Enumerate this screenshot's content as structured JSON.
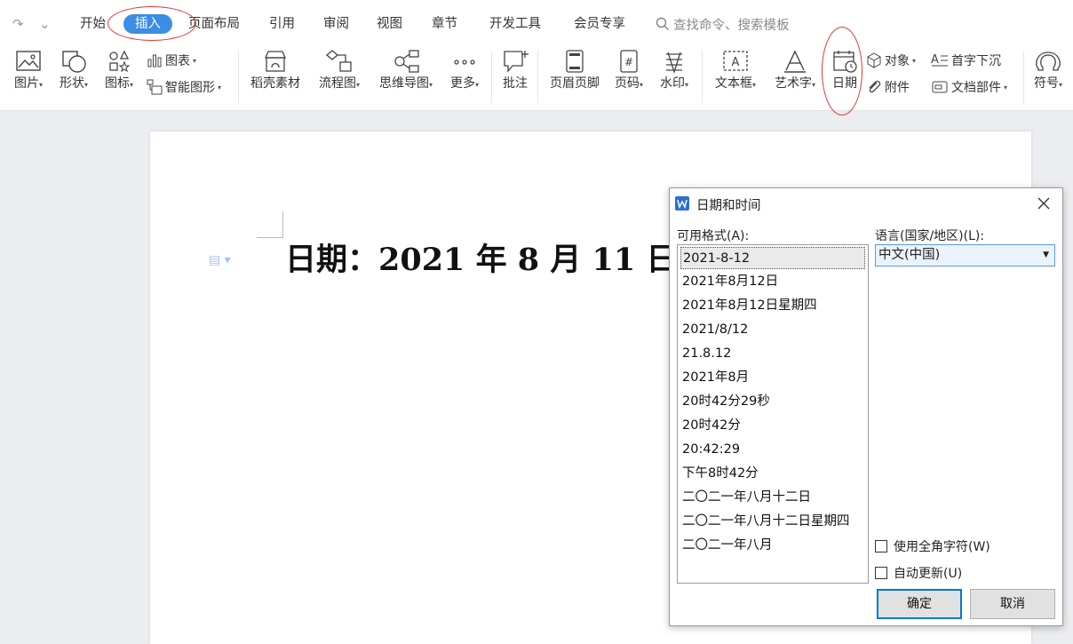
{
  "menu": {
    "tabs": [
      "开始",
      "插入",
      "页面布局",
      "引用",
      "审阅",
      "视图",
      "章节",
      "开发工具",
      "会员专享"
    ],
    "active_tab": "插入",
    "search_placeholder": "查找命令、搜索模板"
  },
  "ribbon": {
    "picture": "图片",
    "shape": "形状",
    "icons": "图标",
    "chart": "图表",
    "smart_graphic": "智能图形",
    "daoke": "稻壳素材",
    "flowchart": "流程图",
    "mindmap": "思维导图",
    "more": "更多",
    "comment": "批注",
    "header_footer": "页眉页脚",
    "page_number": "页码",
    "watermark": "水印",
    "textbox": "文本框",
    "wordart": "艺术字",
    "date": "日期",
    "object": "对象",
    "dropcap": "首字下沉",
    "attachment": "附件",
    "doc_parts": "文档部件",
    "symbol": "符号"
  },
  "document": {
    "text": "日期：2021 年 8 月 11 日"
  },
  "dialog": {
    "title": "日期和时间",
    "formats_label": "可用格式(A):",
    "language_label": "语言(国家/地区)(L):",
    "formats": [
      "2021-8-12",
      "2021年8月12日",
      "2021年8月12日星期四",
      "2021/8/12",
      "21.8.12",
      "2021年8月",
      "20时42分29秒",
      "20时42分",
      "20:42:29",
      "下午8时42分",
      "二〇二一年八月十二日",
      "二〇二一年八月十二日星期四",
      "二〇二一年八月"
    ],
    "selected_format": "2021-8-12",
    "language_value": "中文(中国)",
    "fullwidth_label": "使用全角字符(W)",
    "autoupdate_label": "自动更新(U)",
    "ok_label": "确定",
    "cancel_label": "取消"
  },
  "colors": {
    "accent": "#3d8ce6",
    "highlight": "#e2353a",
    "dialog_focus": "#0078d7"
  }
}
